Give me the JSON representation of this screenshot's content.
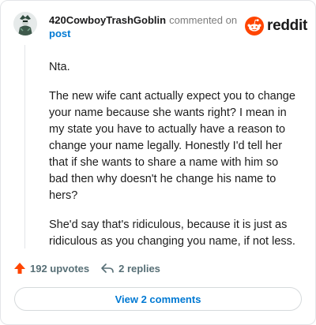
{
  "comment": {
    "username": "420CowboyTrashGoblin",
    "action_text": "commented on",
    "post_link": "post",
    "paragraphs": [
      "Nta.",
      "The new wife cant actually expect you to change your name because she wants right? I mean in my state you have to actually have a reason to change your name legally. Honestly I'd tell her that if she wants to share a name with him so bad then why doesn't he change his name to hers?",
      "She'd say that's ridiculous, because it is just as ridiculous as you changing you name, if not less."
    ],
    "upvotes": "192 upvotes",
    "replies": "2 replies",
    "view_comments": "View 2 comments"
  },
  "brand": {
    "wordmark": "reddit",
    "color": "#ff4500",
    "icon": "reddit-snoo-icon"
  },
  "colors": {
    "upvote": "#ff4500",
    "link": "#0079d3",
    "meta": "#7c7c7c"
  }
}
